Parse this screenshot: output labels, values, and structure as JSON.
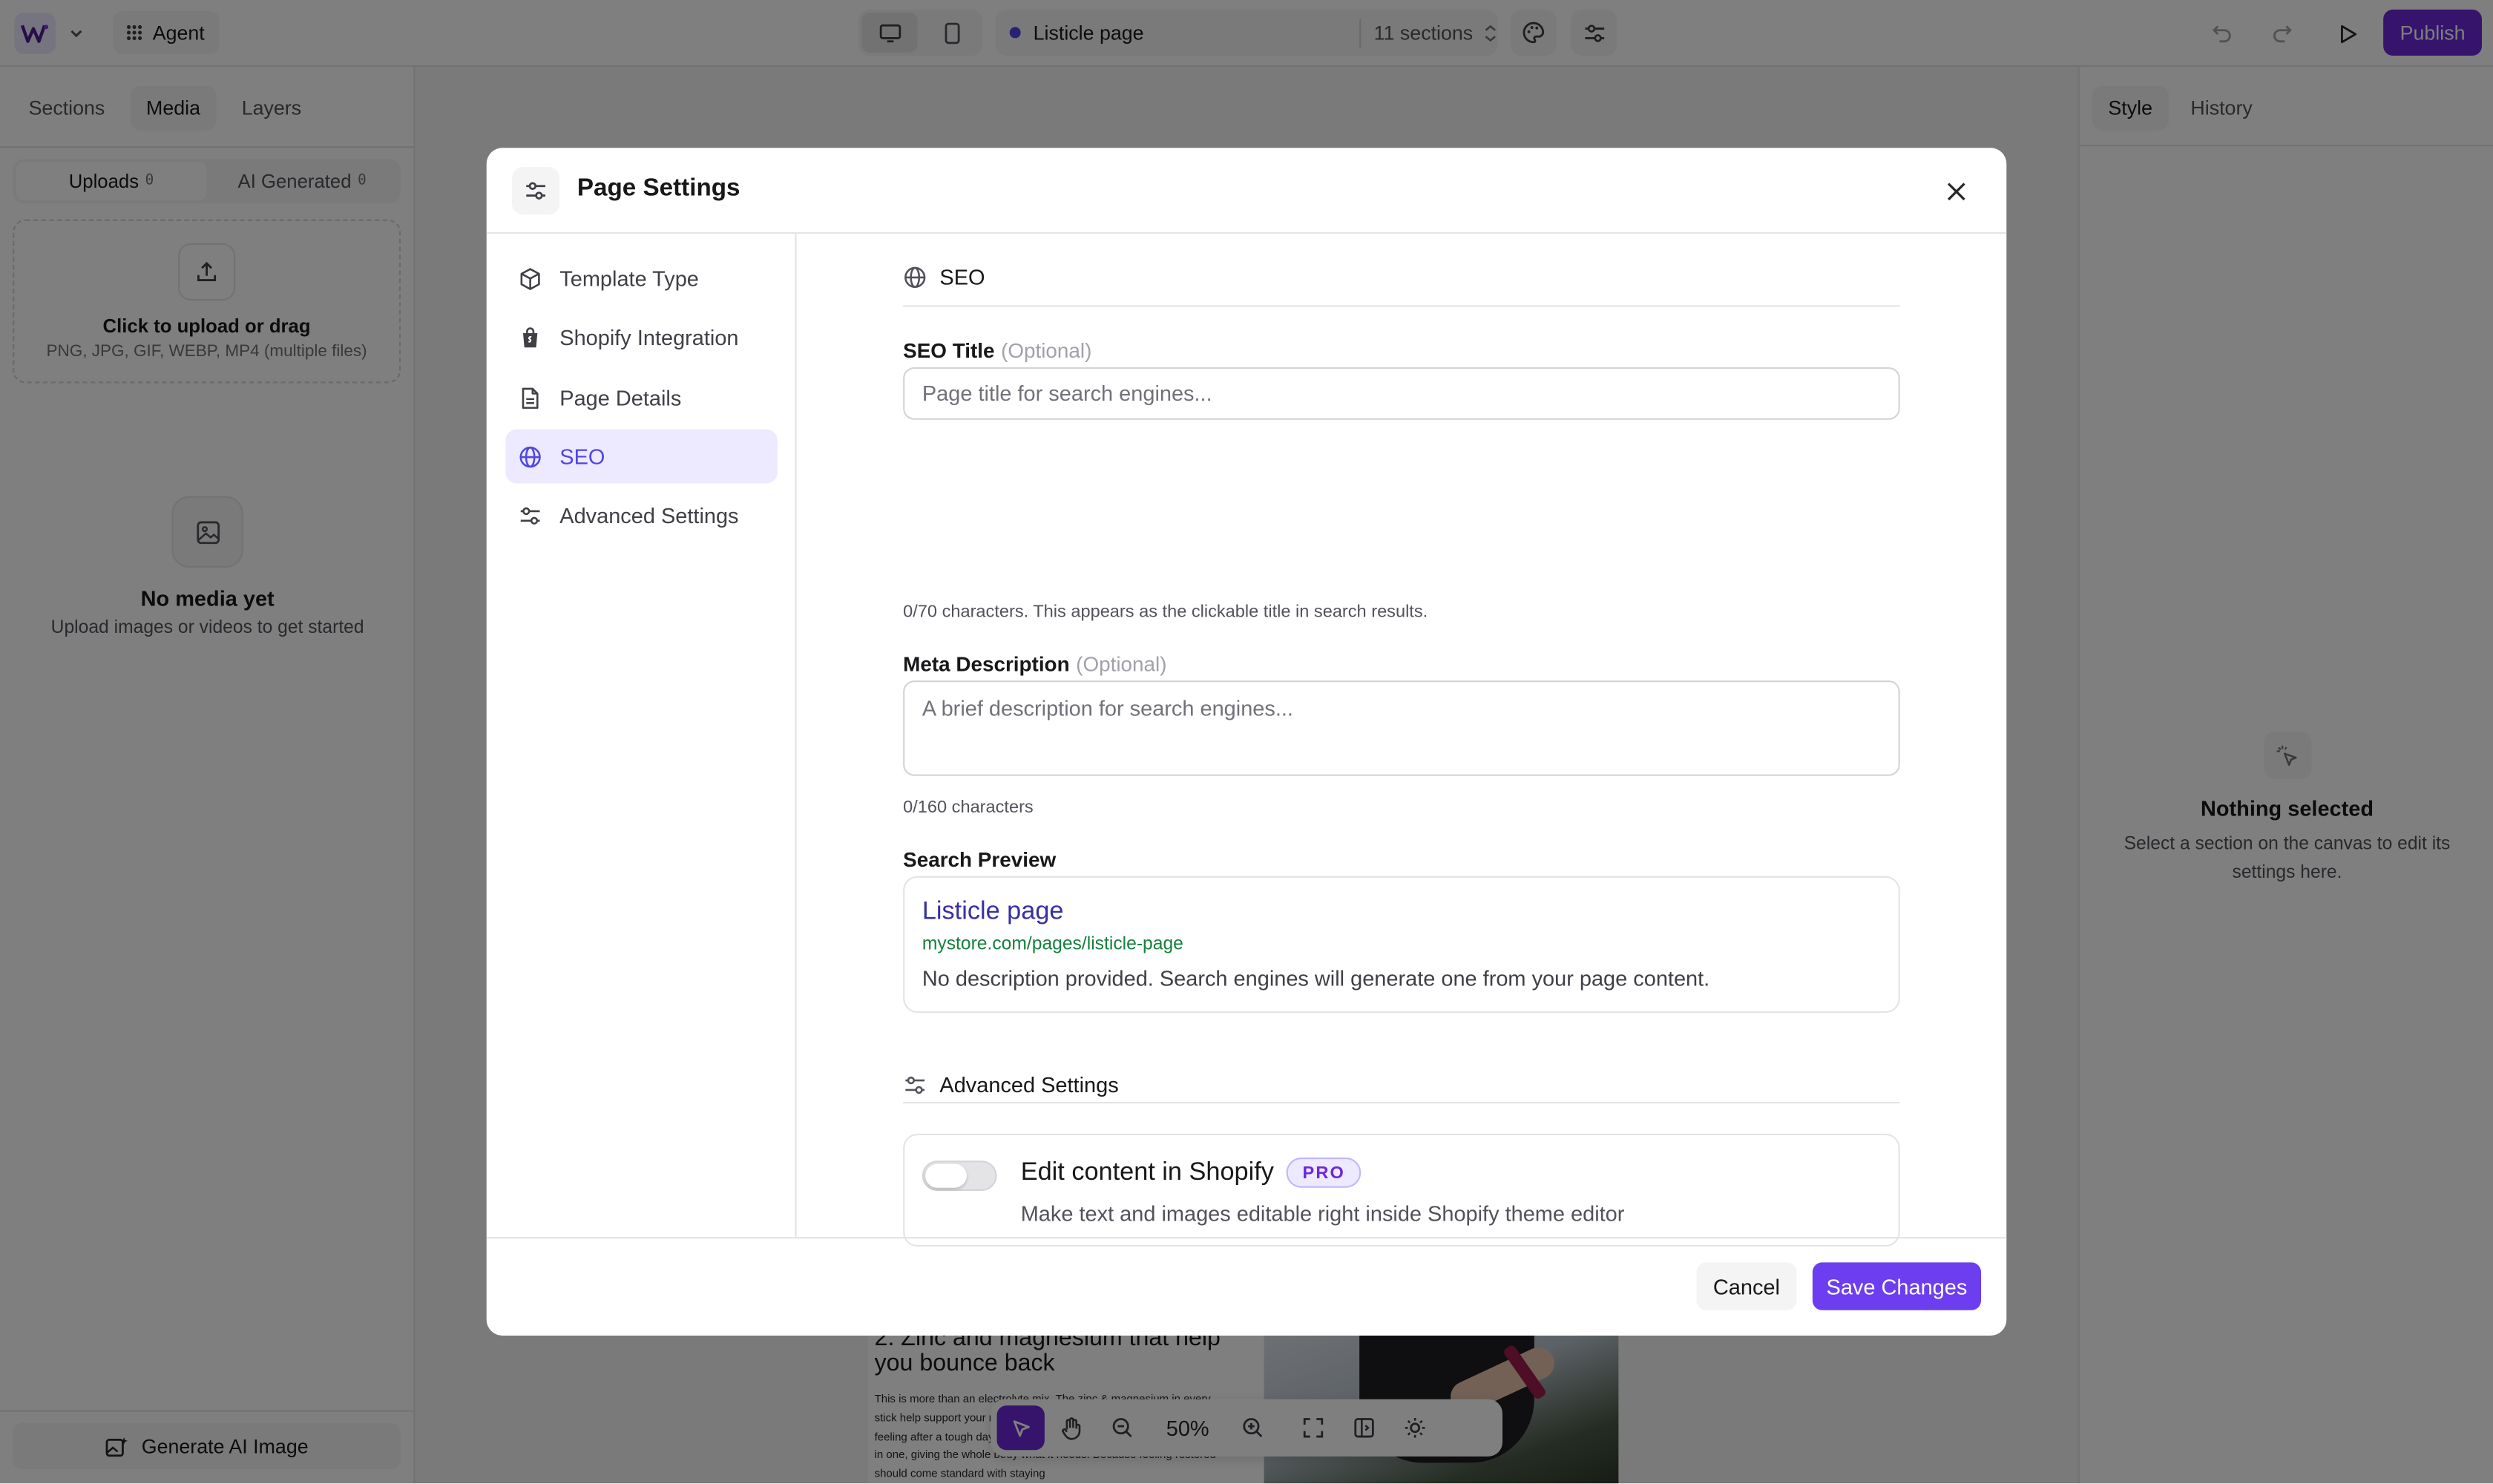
{
  "topbar": {
    "agent_label": "Agent",
    "page_name": "Listicle page",
    "sections_count": "11 sections",
    "publish_label": "Publish"
  },
  "left_panel": {
    "tabs": [
      {
        "label": "Sections"
      },
      {
        "label": "Media"
      },
      {
        "label": "Layers"
      }
    ],
    "active_tab": "Media",
    "segments": [
      {
        "label": "Uploads",
        "count": "0"
      },
      {
        "label": "AI Generated",
        "count": "0"
      }
    ],
    "upload": {
      "title": "Click to upload or drag",
      "formats": "PNG, JPG, GIF, WEBP, MP4 (multiple files)"
    },
    "empty": {
      "title": "No media yet",
      "subtitle": "Upload images or videos to get started"
    },
    "generate_label": "Generate AI Image"
  },
  "right_panel": {
    "tabs": [
      {
        "label": "Style"
      },
      {
        "label": "History"
      }
    ],
    "empty_title": "Nothing selected",
    "empty_subtitle": "Select a section on the canvas to edit its settings here."
  },
  "canvas": {
    "heading": "2. Zinc and magnesium that help you bounce back",
    "body": "This is more than an electrolyte mix. The zinc & magnesium in every stick help support your recovery — and promote that calm, balanced feeling after a tough day or workout. It's hydration and replenishment in one, giving the whole body what it needs. Because feeling restored should come standard with staying",
    "zoom": "50%"
  },
  "modal": {
    "title": "Page Settings",
    "nav": [
      {
        "label": "Template Type",
        "icon": "cube-icon"
      },
      {
        "label": "Shopify Integration",
        "icon": "shopping-bag-icon"
      },
      {
        "label": "Page Details",
        "icon": "document-icon"
      },
      {
        "label": "SEO",
        "icon": "globe-icon"
      },
      {
        "label": "Advanced Settings",
        "icon": "sliders-icon"
      }
    ],
    "active_nav": "SEO",
    "seo": {
      "section_title": "SEO",
      "seo_title_label": "SEO Title",
      "optional": "(Optional)",
      "seo_title_placeholder": "Page title for search engines...",
      "seo_title_value": "",
      "seo_title_help": "0/70 characters. This appears as the clickable title in search results.",
      "meta_label": "Meta Description",
      "meta_placeholder": "A brief description for search engines...",
      "meta_value": "",
      "meta_help": "0/160 characters",
      "preview_label": "Search Preview",
      "preview_title": "Listicle page",
      "preview_url": "mystore.com/pages/listicle-page",
      "preview_desc": "No description provided. Search engines will generate one from your page content."
    },
    "advanced": {
      "section_title": "Advanced Settings",
      "toggle_title": "Edit content in Shopify",
      "badge": "PRO",
      "toggle_sub": "Make text and images editable right inside Shopify theme editor",
      "toggle_on": false
    },
    "cancel_label": "Cancel",
    "save_label": "Save Changes"
  },
  "colors": {
    "accent": "#6d28d9",
    "save_button": "#6d3ef0",
    "active_nav_bg": "#ede9fe",
    "preview_link": "#3730a3",
    "preview_url": "#15803d"
  }
}
